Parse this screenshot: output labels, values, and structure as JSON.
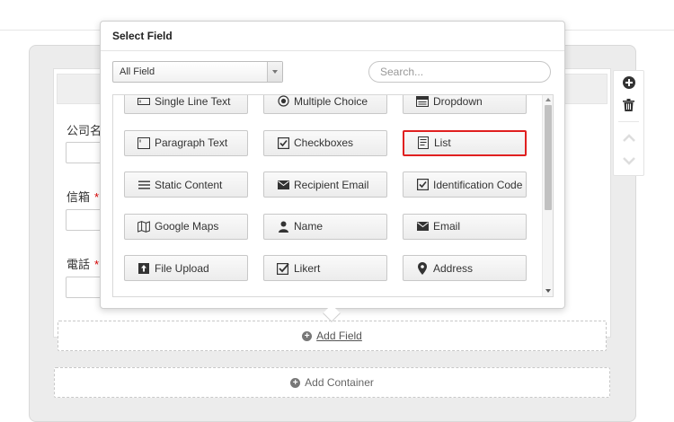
{
  "popup": {
    "title": "Select Field",
    "category_select": "All Field",
    "search_placeholder": "Search..."
  },
  "fields": [
    {
      "label": "Single Line Text",
      "icon": "single-line-text-icon"
    },
    {
      "label": "Multiple Choice",
      "icon": "radio-icon"
    },
    {
      "label": "Dropdown",
      "icon": "dropdown-icon"
    },
    {
      "label": "Paragraph Text",
      "icon": "paragraph-text-icon"
    },
    {
      "label": "Checkboxes",
      "icon": "checkbox-icon"
    },
    {
      "label": "List",
      "icon": "list-icon",
      "selected": true
    },
    {
      "label": "Static Content",
      "icon": "lines-icon"
    },
    {
      "label": "Recipient Email",
      "icon": "envelope-icon"
    },
    {
      "label": "Identification Code",
      "icon": "checkbox-icon"
    },
    {
      "label": "Google Maps",
      "icon": "map-icon"
    },
    {
      "label": "Name",
      "icon": "person-icon"
    },
    {
      "label": "Email",
      "icon": "envelope-icon"
    },
    {
      "label": "File Upload",
      "icon": "upload-icon"
    },
    {
      "label": "Likert",
      "icon": "check-box-icon"
    },
    {
      "label": "Address",
      "icon": "map-marker-icon"
    }
  ],
  "form": {
    "labels": {
      "company": "公司名",
      "email": "信箱",
      "phone": "電話",
      "required_mark": "*"
    },
    "add_field": "Add Field",
    "add_container": "Add Container"
  },
  "colors": {
    "selected_border": "#e02020"
  }
}
